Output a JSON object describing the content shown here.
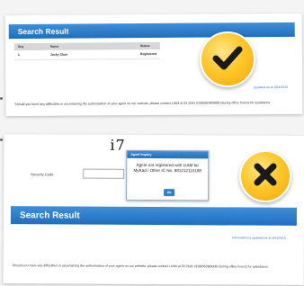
{
  "top_screen": {
    "header_title": "Search Result",
    "table": {
      "columns": [
        "Seq",
        "Name",
        "Status"
      ],
      "rows": [
        {
          "seq": "1",
          "name": "Jacky Chan",
          "status": "Registered"
        }
      ]
    },
    "updated_text": "Updated as at 2/01/2015",
    "note": "Should you have any difficulties in ascertaining the authorisation of your agent on our website, please contact LIAM at 03 2691 0168/0628/0008 (during office hours) for assistance."
  },
  "bottom_screen": {
    "captcha_text": "i7",
    "security_code_label": "Security Code:",
    "security_code_value": "",
    "dialog": {
      "title": "Agent Inquiry",
      "message": "Agent not registered with LIAM for MyKad / Other IC No. 881212115188",
      "ok_label": "Ok"
    },
    "header_title": "Search Result",
    "updated_text": "Information is updated as at 2/01/2015",
    "note": "Should you have any difficulties in ascertaining the authorisation of your agent on our website, please contact LIAM at 03 2691 0168/0628/0008 (during office hours) for assistance."
  },
  "badges": {
    "success_icon": "checkmark-icon",
    "error_icon": "cross-icon"
  },
  "colors": {
    "header_blue": "#1f6fbf",
    "badge_yellow": "#ffc72a",
    "mark_dark": "#1a1a1a"
  }
}
